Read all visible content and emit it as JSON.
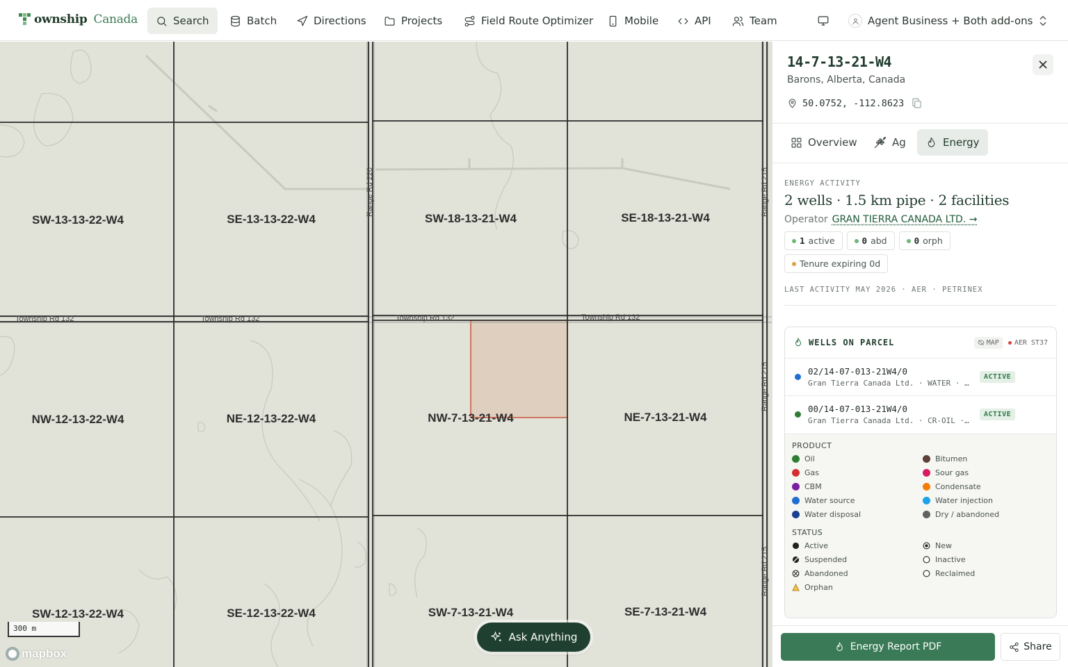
{
  "brand": {
    "name_a": "ownship",
    "name_b": "Canada"
  },
  "nav": [
    {
      "label": "Search",
      "icon": "search-icon",
      "active": true
    },
    {
      "label": "Batch",
      "icon": "database-icon"
    },
    {
      "label": "Directions",
      "icon": "navigation-icon"
    },
    {
      "label": "Projects",
      "icon": "folder-icon"
    },
    {
      "label": "Field Route Optimizer",
      "icon": "route-icon"
    },
    {
      "label": "Mobile",
      "icon": "phone-icon"
    },
    {
      "label": "API",
      "icon": "code-icon"
    },
    {
      "label": "Team",
      "icon": "users-icon"
    }
  ],
  "account": {
    "label": "Agent Business + Both add-ons"
  },
  "map": {
    "parcels": [
      "SW-13-13-22-W4",
      "SE-13-13-22-W4",
      "SW-18-13-21-W4",
      "SE-18-13-21-W4",
      "NW-12-13-22-W4",
      "NE-12-13-22-W4",
      "NW-7-13-21-W4",
      "NE-7-13-21-W4",
      "SW-12-13-22-W4",
      "SE-12-13-22-W4",
      "SW-7-13-21-W4",
      "SE-7-13-21-W4"
    ],
    "roads": {
      "township": "Township Rd 132",
      "range_220": "Range Rd 220",
      "range_215": "Range Rd 215"
    },
    "scale": "300 m",
    "attribution": "mapbox",
    "ask_label": "Ask Anything"
  },
  "panel": {
    "title": "14-7-13-21-W4",
    "location": "Barons, Alberta, Canada",
    "coords": "50.0752, -112.8623",
    "tabs": [
      {
        "label": "Overview",
        "icon": "grid-icon"
      },
      {
        "label": "Ag",
        "icon": "wheat-icon"
      },
      {
        "label": "Energy",
        "icon": "flame-icon",
        "active": true
      }
    ],
    "energy": {
      "eyebrow": "ENERGY ACTIVITY",
      "summary": "2 wells · 1.5 km pipe · 2 facilities",
      "operator_label": "Operator",
      "operator_name": "GRAN TIERRA CANADA LTD. →",
      "chips": [
        {
          "num": "1",
          "label": "active",
          "color": "#4caf50"
        },
        {
          "num": "0",
          "label": "abd",
          "color": "#4caf50"
        },
        {
          "num": "0",
          "label": "orph",
          "color": "#4caf50"
        }
      ],
      "tenure": "Tenure expiring 0d",
      "tenure_color": "#e0a040",
      "activity_line": "LAST ACTIVITY MAY 2026 · AER · PETRINEX"
    },
    "wells": {
      "title": "WELLS ON PARCEL",
      "map_pill": "MAP",
      "source": "AER ST37",
      "items": [
        {
          "id": "02/14-07-013-21W4/0",
          "meta": "Gran Tierra Canada Ltd. · WATER · SOURCE",
          "status": "ACTIVE",
          "color": "#1e6fd1"
        },
        {
          "id": "00/14-07-013-21W4/0",
          "meta": "Gran Tierra Canada Ltd. · CR-OIL · PUMPING",
          "status": "ACTIVE",
          "color": "#2e7d32"
        }
      ]
    },
    "legend": {
      "product_title": "PRODUCT",
      "products": [
        {
          "label": "Oil",
          "color": "#2e7d32"
        },
        {
          "label": "Bitumen",
          "color": "#5d4037"
        },
        {
          "label": "Gas",
          "color": "#d32f2f"
        },
        {
          "label": "Sour gas",
          "color": "#d81b60"
        },
        {
          "label": "CBM",
          "color": "#7b1fa2"
        },
        {
          "label": "Condensate",
          "color": "#f57c00"
        },
        {
          "label": "Water source",
          "color": "#1e6fd1"
        },
        {
          "label": "Water injection",
          "color": "#1aa3e8"
        },
        {
          "label": "Water disposal",
          "color": "#1a3f8f"
        },
        {
          "label": "Dry / abandoned",
          "color": "#616161"
        }
      ],
      "status_title": "STATUS",
      "statuses": [
        {
          "label": "Active",
          "icon": "active"
        },
        {
          "label": "New",
          "icon": "new"
        },
        {
          "label": "Suspended",
          "icon": "suspended"
        },
        {
          "label": "Inactive",
          "icon": "inactive"
        },
        {
          "label": "Abandoned",
          "icon": "abandoned"
        },
        {
          "label": "Reclaimed",
          "icon": "reclaimed"
        },
        {
          "label": "Orphan",
          "icon": "orphan"
        }
      ]
    },
    "footer": {
      "pdf_label": "Energy Report PDF",
      "share_label": "Share"
    }
  }
}
